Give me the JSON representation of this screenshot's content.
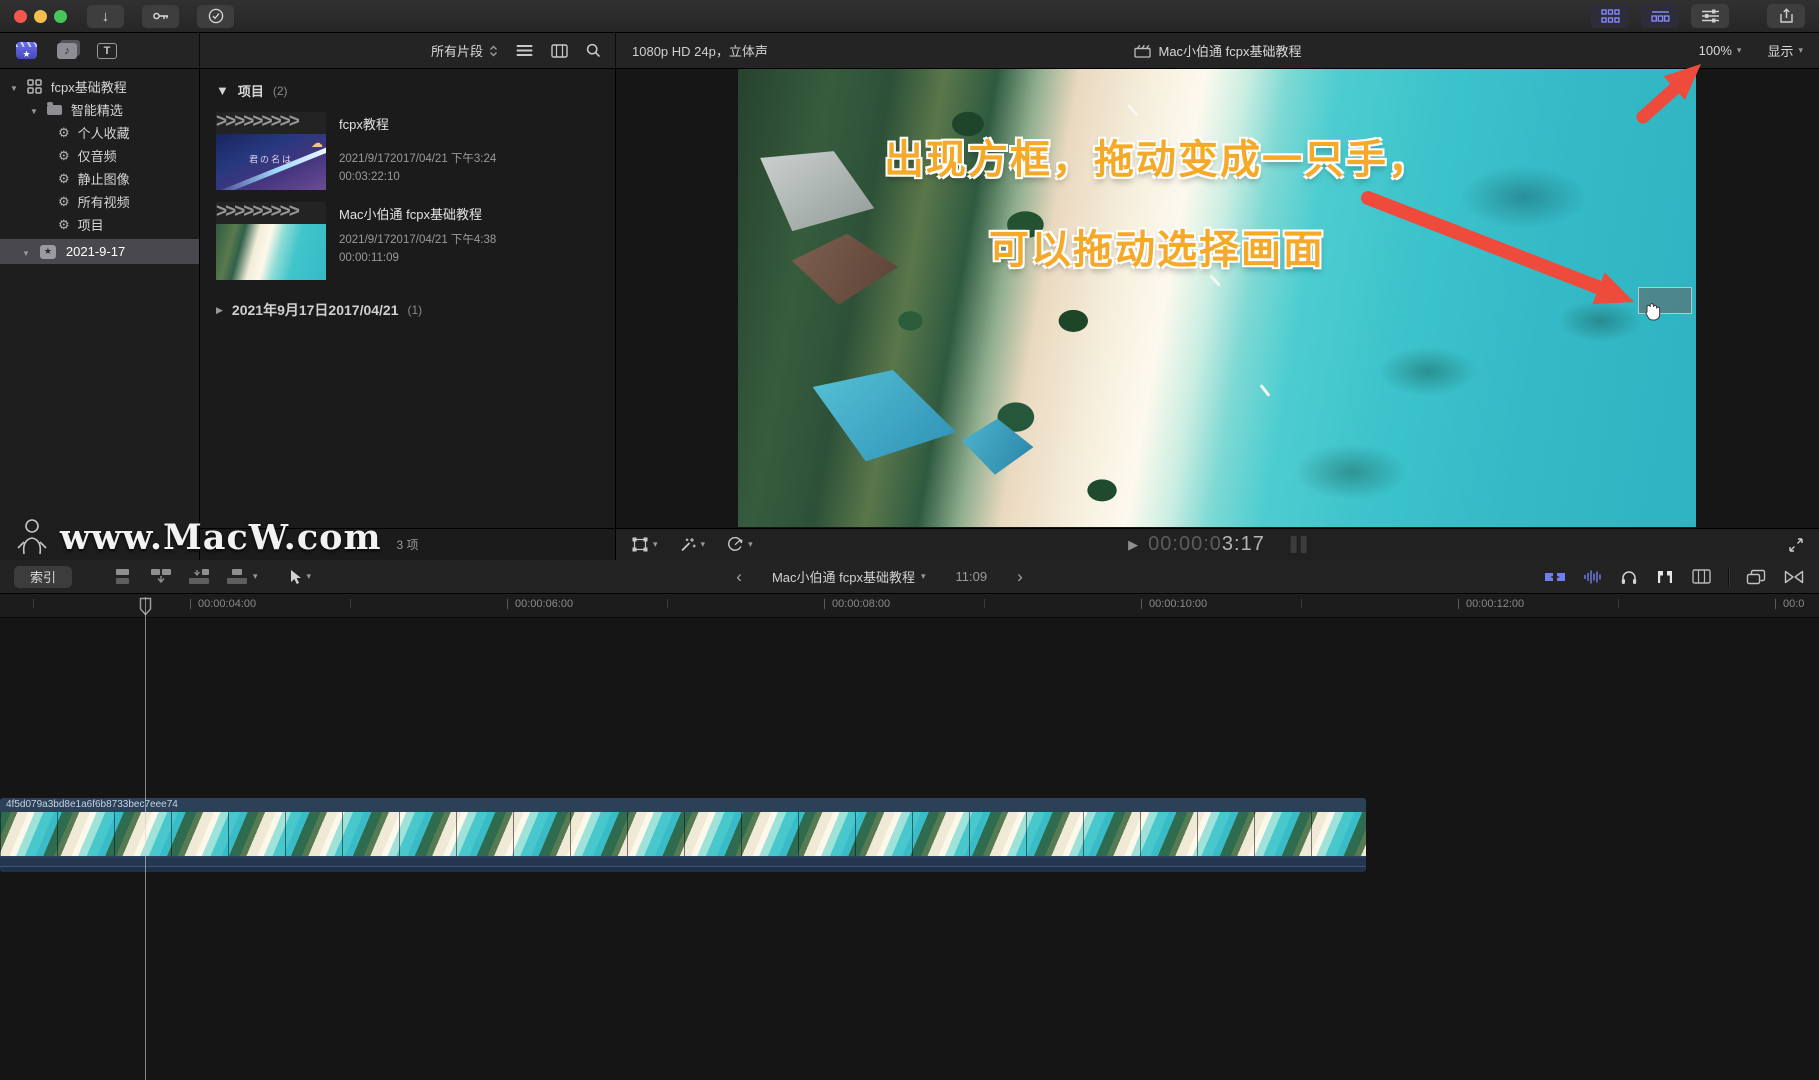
{
  "colors": {
    "accent": "#8486f8",
    "arrow-red": "#ee4b3c",
    "annotation-orange": "#f5a928",
    "clip-bar-blue": "#2c4157",
    "selection-gray": "#48484d",
    "water-teal": "#3cc3cb"
  },
  "browser_toolbar": {
    "filter_label": "所有片段"
  },
  "viewer_toolbar": {
    "format_info": "1080p HD 24p，立体声",
    "project_title": "Mac小伯通 fcpx基础教程",
    "zoom_level": "100%",
    "view_label": "显示"
  },
  "sidebar": {
    "library_name": "fcpx基础教程",
    "smart_collection_group": "智能精选",
    "gear_items": [
      "个人收藏",
      "仅音频",
      "静止图像",
      "所有视频",
      "项目"
    ],
    "event_name": "2021-9-17"
  },
  "browser": {
    "group_label": "项目",
    "group_count": "(2)",
    "clip_chevrons": ">>>>>>>>>",
    "clips": [
      {
        "title": "fcpx教程",
        "date": "2021/9/172017/04/21 下午3:24",
        "duration": "00:03:22:10",
        "thumb_label": "君の名は"
      },
      {
        "title": "Mac小伯通 fcpx基础教程",
        "date": "2021/9/172017/04/21 下午4:38",
        "duration": "00:00:11:09"
      }
    ],
    "collapsed_group_label": "2021年9月17日2017/04/21",
    "collapsed_group_count": "(1)",
    "status": "3 项"
  },
  "watermark": {
    "text": "www.MacW.com"
  },
  "viewer": {
    "annotation_line1": "出现方框，拖动变成一只手，",
    "annotation_line2": "可以拖动选择画面",
    "timecode_dim": "00:00:0",
    "timecode_bright": "3:17"
  },
  "timeline_toolbar": {
    "index_button": "索引",
    "prev": "‹",
    "next": "›",
    "clip_nav_title": "Mac小伯通 fcpx基础教程",
    "clip_nav_duration": "11:09"
  },
  "ruler": {
    "ticks": [
      "00:00:04:00",
      "00:00:06:00",
      "00:00:08:00",
      "00:00:10:00",
      "00:00:12:00",
      "00:0"
    ]
  },
  "timeline": {
    "clip_name": "4f5d079a3bd8e1a6f6b8733bec7eee74"
  }
}
